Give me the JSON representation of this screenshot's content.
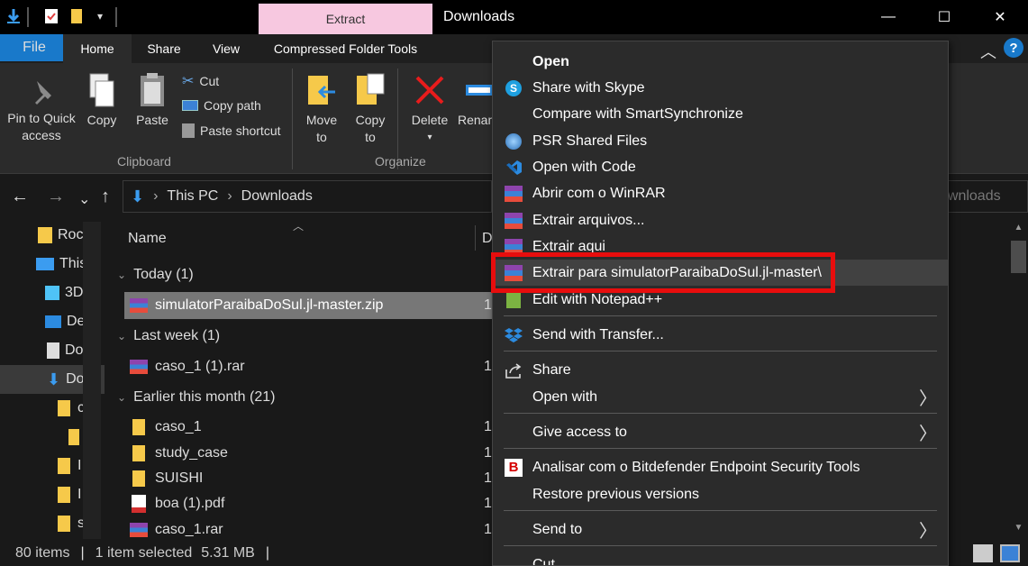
{
  "window": {
    "title": "Downloads",
    "context_tab": "Extract",
    "minimize": "—",
    "maximize": "☐",
    "close": "✕"
  },
  "ribbon_tabs": {
    "file": "File",
    "home": "Home",
    "share": "Share",
    "view": "View",
    "compressed": "Compressed Folder Tools"
  },
  "ribbon": {
    "pin": "Pin to Quick access",
    "copy": "Copy",
    "paste": "Paste",
    "cut": "Cut",
    "copy_path": "Copy path",
    "paste_shortcut": "Paste shortcut",
    "clipboard": "Clipboard",
    "move_to": "Move to",
    "copy_to": "Copy to",
    "delete": "Delete",
    "rename": "Renam",
    "organize": "Organize"
  },
  "address": {
    "this_pc": "This PC",
    "downloads": "Downloads",
    "search_placeholder": "ownloads"
  },
  "nav_pane": [
    {
      "label": "Roc"
    },
    {
      "label": "This"
    },
    {
      "label": "3D"
    },
    {
      "label": "De"
    },
    {
      "label": "Do"
    },
    {
      "label": "Do"
    },
    {
      "label": "c"
    },
    {
      "label": ""
    },
    {
      "label": "I"
    },
    {
      "label": "I"
    },
    {
      "label": "s"
    }
  ],
  "filelist": {
    "col_name": "Name",
    "col_date": "D",
    "groups": {
      "today": "Today (1)",
      "last_week": "Last week (1)",
      "earlier": "Earlier this month (21)"
    },
    "files": [
      {
        "name": "simulatorParaibaDoSul.jl-master.zip",
        "date": "1"
      },
      {
        "name": "caso_1 (1).rar",
        "date": "1"
      },
      {
        "name": "caso_1",
        "date": "1"
      },
      {
        "name": "study_case",
        "date": "1"
      },
      {
        "name": "SUISHI",
        "date": "1"
      },
      {
        "name": "boa (1).pdf",
        "date": "1"
      },
      {
        "name": "caso_1.rar",
        "date": "1"
      }
    ]
  },
  "status": {
    "items": "80 items",
    "selected": "1 item selected",
    "size": "5.31 MB"
  },
  "context_menu": {
    "open": "Open",
    "skype": "Share with Skype",
    "smartsync": "Compare with SmartSynchronize",
    "psr": "PSR Shared Files",
    "code": "Open with Code",
    "winrar_open": "Abrir com o WinRAR",
    "extract_files": "Extrair arquivos...",
    "extract_here": "Extrair aqui",
    "extract_to": "Extrair para simulatorParaibaDoSul.jl-master\\",
    "notepad": "Edit with Notepad++",
    "transfer": "Send with Transfer...",
    "share": "Share",
    "open_with": "Open with",
    "give_access": "Give access to",
    "bitdefender": "Analisar com o Bitdefender Endpoint Security Tools",
    "restore": "Restore previous versions",
    "send_to": "Send to",
    "cut": "Cut"
  },
  "colors": {
    "accent": "#1979ca",
    "context_tab": "#f7c8e0",
    "highlight": "#e80d0d"
  }
}
